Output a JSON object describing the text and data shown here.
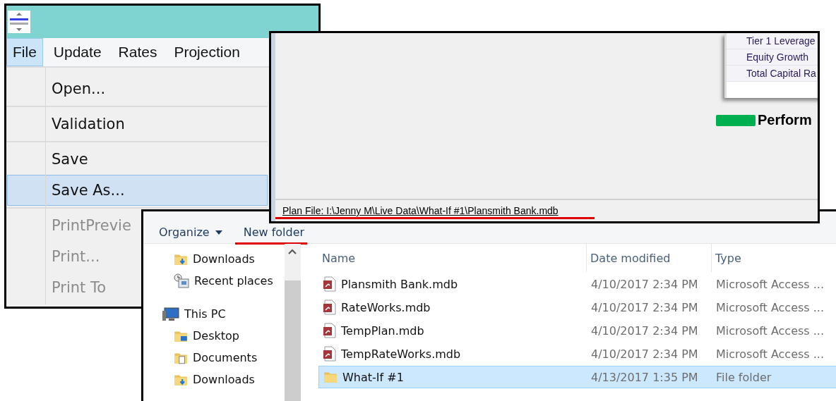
{
  "menu_window": {
    "menu_bar": [
      {
        "label": "File",
        "selected": true
      },
      {
        "label": "Update",
        "selected": false
      },
      {
        "label": "Rates",
        "selected": false
      },
      {
        "label": "Projection",
        "selected": false
      }
    ],
    "menu_groups": [
      [
        {
          "label": "Open...",
          "selected": false,
          "disabled": false
        }
      ],
      [
        {
          "label": "Validation",
          "selected": false,
          "disabled": false
        }
      ],
      [
        {
          "label": "Save",
          "selected": false,
          "disabled": false
        },
        {
          "label": "Save As...",
          "selected": true,
          "disabled": false
        }
      ],
      [
        {
          "label": "PrintPrevie",
          "selected": false,
          "disabled": true
        },
        {
          "label": "Print...",
          "selected": false,
          "disabled": true
        },
        {
          "label": "Print To",
          "selected": false,
          "disabled": true
        }
      ]
    ]
  },
  "report_window": {
    "metrics": [
      "Tier 1 Leverage",
      "Equity Growth",
      "Total Capital Ra"
    ],
    "legend": {
      "color": "#00b050",
      "label": "Perform"
    },
    "status_bar": "Plan File: I:\\Jenny M\\Live Data\\What-If #1\\Plansmith Bank.mdb"
  },
  "save_dialog": {
    "toolbar": [
      {
        "label": "Organize",
        "kind": "dropdown"
      },
      {
        "label": "New folder",
        "kind": "plain"
      }
    ],
    "nav_sections": [
      {
        "items": [
          {
            "label": "Downloads",
            "kind": "downloads"
          },
          {
            "label": "Recent places",
            "kind": "recent"
          }
        ]
      },
      {
        "label": "This PC",
        "kind": "pc",
        "items": [
          {
            "label": "Desktop",
            "kind": "desktop"
          },
          {
            "label": "Documents",
            "kind": "documents"
          },
          {
            "label": "Downloads",
            "kind": "downloads"
          }
        ]
      }
    ],
    "columns": [
      "Name",
      "Date modified",
      "Type"
    ],
    "rows": [
      {
        "name": "Plansmith Bank.mdb",
        "date": "4/10/2017 2:34 PM",
        "type": "Microsoft Access ...",
        "kind": "access",
        "selected": false
      },
      {
        "name": "RateWorks.mdb",
        "date": "4/10/2017 2:34 PM",
        "type": "Microsoft Access ...",
        "kind": "access",
        "selected": false
      },
      {
        "name": "TempPlan.mdb",
        "date": "4/10/2017 2:34 PM",
        "type": "Microsoft Access ...",
        "kind": "access",
        "selected": false
      },
      {
        "name": "TempRateWorks.mdb",
        "date": "4/10/2017 2:34 PM",
        "type": "Microsoft Access ...",
        "kind": "access",
        "selected": false
      },
      {
        "name": "What-If #1",
        "date": "4/13/2017 1:35 PM",
        "type": "File folder",
        "kind": "folder",
        "selected": true
      }
    ]
  }
}
